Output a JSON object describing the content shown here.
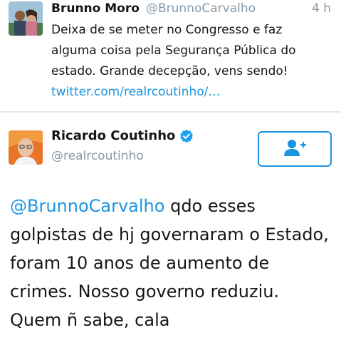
{
  "reply_tweet": {
    "display_name": "Brunno Moro",
    "handle": "@BrunnoCarvalho",
    "time": "4 h",
    "text_lines": [
      "Deixa de se meter no Congresso e faz",
      "alguma coisa pela Segurança Pública do",
      "estado. Grande decepção, vens sendo!"
    ],
    "link": "twitter.com/realrcoutinho/…"
  },
  "main_tweet": {
    "display_name": "Ricardo Coutinho",
    "handle": "@realrcoutinho",
    "verified_icon": "verified-badge-icon",
    "follow_icon": "add-user-icon",
    "mention": "@BrunnoCarvalho",
    "text_lines": [
      " qdo esses",
      "golpistas de hj governaram o Estado,",
      "foram 10 anos de aumento de",
      "crimes. Nosso governo reduziu.",
      "Quem ñ sabe, cala"
    ]
  },
  "colors": {
    "link": "#1b95e0",
    "secondary_text": "#8899a6",
    "primary_text": "#14171a",
    "divider": "#e1e8ed"
  }
}
